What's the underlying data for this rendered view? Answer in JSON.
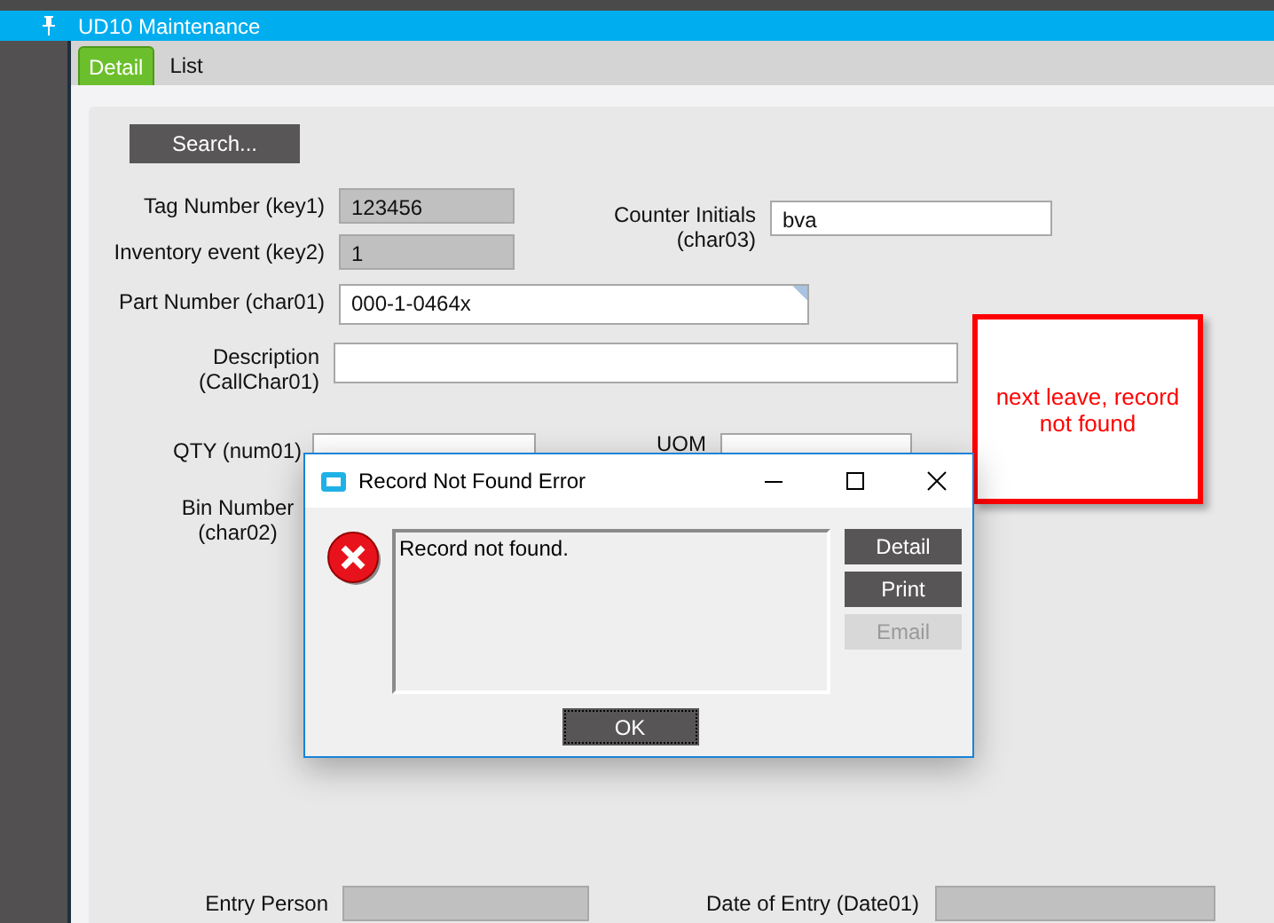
{
  "window": {
    "title": "UD10 Maintenance"
  },
  "tabs": [
    {
      "label": "Detail",
      "selected": true
    },
    {
      "label": "List",
      "selected": false
    }
  ],
  "search_button": "Search...",
  "form": {
    "tag_number": {
      "label": "Tag Number (key1)",
      "value": "123456",
      "disabled": true
    },
    "inventory_event": {
      "label": "Inventory event (key2)",
      "value": "1",
      "disabled": true
    },
    "counter_initials": {
      "label": "Counter Initials (char03)",
      "value": "bva",
      "disabled": false
    },
    "part_number": {
      "label": "Part Number (char01)",
      "value": "000-1-0464x",
      "disabled": false
    },
    "description": {
      "label": "Description (CallChar01)",
      "disabled": false
    },
    "qty": {
      "label": "QTY (num01)",
      "disabled": false
    },
    "uom": {
      "label": "UOM",
      "disabled": false
    },
    "bin_number": {
      "label": "Bin Number (char02)"
    },
    "entry_person": {
      "label": "Entry Person",
      "disabled": true
    },
    "date_of_entry": {
      "label": "Date of Entry (Date01)",
      "disabled": true
    }
  },
  "note": {
    "text": "next leave, record not found"
  },
  "dialog": {
    "title": "Record Not Found Error",
    "message": "Record not found.",
    "buttons": [
      {
        "label": "Detail",
        "disabled": false
      },
      {
        "label": "Print",
        "disabled": false
      },
      {
        "label": "Email",
        "disabled": true
      }
    ],
    "ok": "OK"
  }
}
